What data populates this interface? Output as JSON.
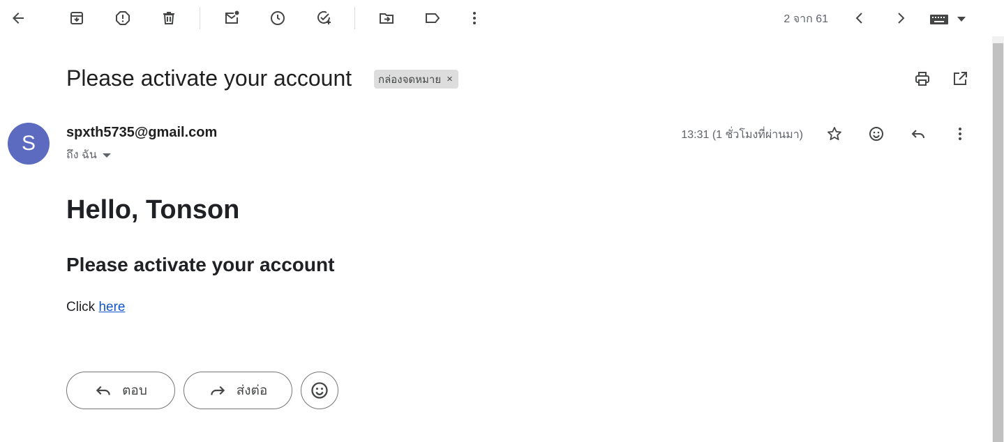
{
  "toolbar": {
    "page_count": "2 จาก 61",
    "icons": [
      "back-arrow-icon",
      "archive-icon",
      "report-spam-icon",
      "delete-icon",
      "mark-unread-icon",
      "snooze-icon",
      "add-task-icon",
      "move-to-icon",
      "label-icon",
      "more-vert-icon",
      "prev-icon",
      "next-icon",
      "keyboard-icon"
    ]
  },
  "email": {
    "subject": "Please activate your account",
    "label": "กล่องจดหมาย",
    "label_remove": "×",
    "sender": {
      "avatar_letter": "S",
      "avatar_color": "#5c6bc0",
      "email": "spxth5735@gmail.com",
      "to": "ถึง ฉัน"
    },
    "timestamp": "13:31 (1 ชั่วโมงที่ผ่านมา)",
    "body": {
      "greeting": "Hello, Tonson",
      "heading": "Please activate your account",
      "click_text": "Click ",
      "link_text": "here"
    }
  },
  "actions": {
    "reply_label": "ตอบ",
    "forward_label": "ส่งต่อ"
  }
}
